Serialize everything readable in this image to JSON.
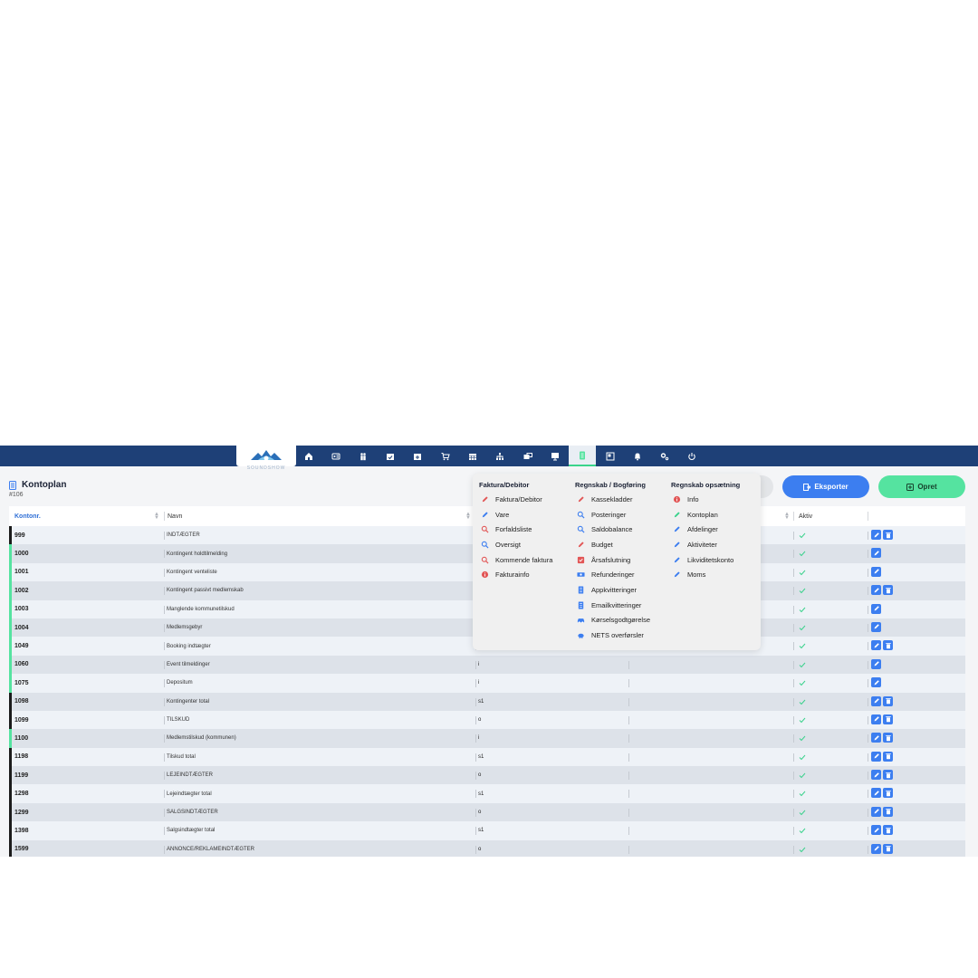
{
  "app": {
    "logo_text": "SOUNDSHOW",
    "nav_icons": [
      "home-icon",
      "id-card-icon",
      "users-icon",
      "calendar-check-icon",
      "calendar-plus-icon",
      "cart-icon",
      "calendar-grid-icon",
      "sitemap-icon",
      "mail-icon",
      "presentation-icon",
      "accounting-icon",
      "window-icon",
      "bell-icon",
      "cogs-icon",
      "power-icon"
    ],
    "active_nav": "accounting-icon"
  },
  "page": {
    "title": "Kontoplan",
    "subtitle": "#106"
  },
  "buttons": {
    "export_label": "Eksporter",
    "create_label": "Opret"
  },
  "colors": {
    "nav_bg": "#1e4077",
    "accent_blue": "#3c7ef0",
    "accent_green": "#55e3a0",
    "row_dark_bar": "#1b1b1b",
    "row_green_bar": "#55e3a0",
    "check_green": "#3bd28c"
  },
  "table": {
    "headers": {
      "konto": "Kontonr.",
      "navn": "Navn",
      "aktiv": "Aktiv"
    },
    "rows": [
      {
        "konto": "999",
        "navn": "INDTÆGTER",
        "type": "",
        "bar": "dark",
        "delete": true
      },
      {
        "konto": "1000",
        "navn": "Kontingent holdtilmelding",
        "type": "",
        "bar": "green",
        "delete": false
      },
      {
        "konto": "1001",
        "navn": "Kontingent venteliste",
        "type": "",
        "bar": "green",
        "delete": false
      },
      {
        "konto": "1002",
        "navn": "Kontingent passivt medlemskab",
        "type": "",
        "bar": "green",
        "delete": true
      },
      {
        "konto": "1003",
        "navn": "Manglende kommunetilskud",
        "type": "",
        "bar": "green",
        "delete": false
      },
      {
        "konto": "1004",
        "navn": "Medlemsgebyr",
        "type": "",
        "bar": "green",
        "delete": false
      },
      {
        "konto": "1049",
        "navn": "Booking indtægter",
        "type": "",
        "bar": "green",
        "delete": true
      },
      {
        "konto": "1060",
        "navn": "Event tilmeldinger",
        "type": "i",
        "bar": "green",
        "delete": false
      },
      {
        "konto": "1075",
        "navn": "Depositum",
        "type": "i",
        "bar": "green",
        "delete": false
      },
      {
        "konto": "1098",
        "navn": "Kontingenter total",
        "type": "s1",
        "bar": "dark",
        "delete": true
      },
      {
        "konto": "1099",
        "navn": "TILSKUD",
        "type": "o",
        "bar": "dark",
        "delete": true
      },
      {
        "konto": "1100",
        "navn": "Medlemstilskud (kommunen)",
        "type": "i",
        "bar": "green",
        "delete": true
      },
      {
        "konto": "1198",
        "navn": "Tilskud total",
        "type": "s1",
        "bar": "dark",
        "delete": true
      },
      {
        "konto": "1199",
        "navn": "LEJEINDTÆGTER",
        "type": "o",
        "bar": "dark",
        "delete": true
      },
      {
        "konto": "1298",
        "navn": "Lejeindtægter total",
        "type": "s1",
        "bar": "dark",
        "delete": true
      },
      {
        "konto": "1299",
        "navn": "SALGSINDTÆGTER",
        "type": "o",
        "bar": "dark",
        "delete": true
      },
      {
        "konto": "1398",
        "navn": "Salgsindtægter total",
        "type": "s1",
        "bar": "dark",
        "delete": true
      },
      {
        "konto": "1599",
        "navn": "ANNONCE/REKLAMEINDTÆGTER",
        "type": "o",
        "bar": "dark",
        "delete": true
      }
    ]
  },
  "dropdown": {
    "columns": [
      {
        "heading": "Faktura/Debitor",
        "items": [
          {
            "label": "Faktura/Debitor",
            "icon": "pencil-icon",
            "color": "#e25656"
          },
          {
            "label": "Vare",
            "icon": "pencil-icon",
            "color": "#3c7ef0"
          },
          {
            "label": "Forfaldsliste",
            "icon": "search-icon",
            "color": "#e25656"
          },
          {
            "label": "Oversigt",
            "icon": "search-icon",
            "color": "#3c7ef0"
          },
          {
            "label": "Kommende faktura",
            "icon": "search-icon",
            "color": "#e25656"
          },
          {
            "label": "Fakturainfo",
            "icon": "info-icon",
            "color": "#e25656"
          }
        ]
      },
      {
        "heading": "Regnskab / Bogføring",
        "items": [
          {
            "label": "Kassekladder",
            "icon": "pencil-icon",
            "color": "#e25656"
          },
          {
            "label": "Posteringer",
            "icon": "search-icon",
            "color": "#3c7ef0"
          },
          {
            "label": "Saldobalance",
            "icon": "search-icon",
            "color": "#3c7ef0"
          },
          {
            "label": "Budget",
            "icon": "pencil-icon",
            "color": "#e25656"
          },
          {
            "label": "Årsafslutning",
            "icon": "check-square-icon",
            "color": "#e25656"
          },
          {
            "label": "Refunderinger",
            "icon": "money-icon",
            "color": "#3c7ef0"
          },
          {
            "label": "Appkvitteringer",
            "icon": "document-icon",
            "color": "#3c7ef0"
          },
          {
            "label": "Emailkvitteringer",
            "icon": "document-icon",
            "color": "#3c7ef0"
          },
          {
            "label": "Kørselsgodtgørelse",
            "icon": "car-icon",
            "color": "#3c7ef0"
          },
          {
            "label": "NETS overførsler",
            "icon": "piggy-bank-icon",
            "color": "#3c7ef0"
          }
        ]
      },
      {
        "heading": "Regnskab opsætning",
        "items": [
          {
            "label": "Info",
            "icon": "info-icon",
            "color": "#e25656"
          },
          {
            "label": "Kontoplan",
            "icon": "pencil-icon",
            "color": "#3bd28c"
          },
          {
            "label": "Afdelinger",
            "icon": "pencil-icon",
            "color": "#3c7ef0"
          },
          {
            "label": "Aktiviteter",
            "icon": "pencil-icon",
            "color": "#3c7ef0"
          },
          {
            "label": "Likviditetskonto",
            "icon": "pencil-icon",
            "color": "#3c7ef0"
          },
          {
            "label": "Moms",
            "icon": "pencil-icon",
            "color": "#3c7ef0"
          }
        ]
      }
    ]
  }
}
